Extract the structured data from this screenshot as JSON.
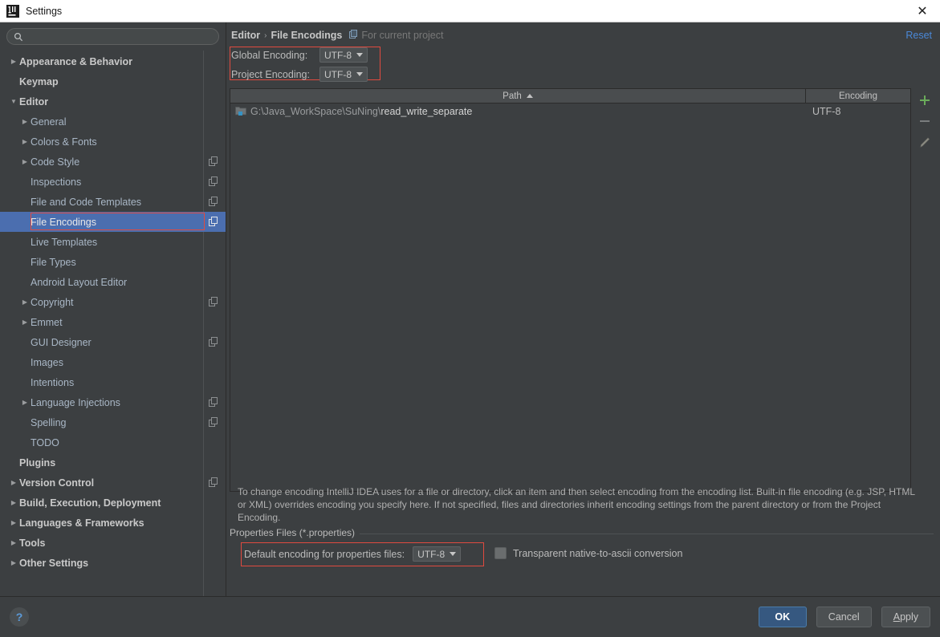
{
  "window": {
    "title": "Settings",
    "logo_text": "IJ",
    "close_icon": "✕"
  },
  "sidebar": {
    "search": {
      "placeholder": "",
      "value": "",
      "icon": "search-icon"
    },
    "items": [
      {
        "label": "Appearance & Behavior",
        "level": 0,
        "arrow": "▶",
        "bold": true,
        "selected": false,
        "mod": false
      },
      {
        "label": "Keymap",
        "level": 0,
        "arrow": "",
        "bold": true,
        "selected": false,
        "mod": false
      },
      {
        "label": "Editor",
        "level": 0,
        "arrow": "▼",
        "bold": true,
        "selected": false,
        "mod": false
      },
      {
        "label": "General",
        "level": 1,
        "arrow": "▶",
        "bold": false,
        "selected": false,
        "mod": false
      },
      {
        "label": "Colors & Fonts",
        "level": 1,
        "arrow": "▶",
        "bold": false,
        "selected": false,
        "mod": false
      },
      {
        "label": "Code Style",
        "level": 1,
        "arrow": "▶",
        "bold": false,
        "selected": false,
        "mod": true
      },
      {
        "label": "Inspections",
        "level": 1,
        "arrow": "",
        "bold": false,
        "selected": false,
        "mod": true
      },
      {
        "label": "File and Code Templates",
        "level": 1,
        "arrow": "",
        "bold": false,
        "selected": false,
        "mod": true
      },
      {
        "label": "File Encodings",
        "level": 1,
        "arrow": "",
        "bold": false,
        "selected": true,
        "mod": true
      },
      {
        "label": "Live Templates",
        "level": 1,
        "arrow": "",
        "bold": false,
        "selected": false,
        "mod": false
      },
      {
        "label": "File Types",
        "level": 1,
        "arrow": "",
        "bold": false,
        "selected": false,
        "mod": false
      },
      {
        "label": "Android Layout Editor",
        "level": 1,
        "arrow": "",
        "bold": false,
        "selected": false,
        "mod": false
      },
      {
        "label": "Copyright",
        "level": 1,
        "arrow": "▶",
        "bold": false,
        "selected": false,
        "mod": true
      },
      {
        "label": "Emmet",
        "level": 1,
        "arrow": "▶",
        "bold": false,
        "selected": false,
        "mod": false
      },
      {
        "label": "GUI Designer",
        "level": 1,
        "arrow": "",
        "bold": false,
        "selected": false,
        "mod": true
      },
      {
        "label": "Images",
        "level": 1,
        "arrow": "",
        "bold": false,
        "selected": false,
        "mod": false
      },
      {
        "label": "Intentions",
        "level": 1,
        "arrow": "",
        "bold": false,
        "selected": false,
        "mod": false
      },
      {
        "label": "Language Injections",
        "level": 1,
        "arrow": "▶",
        "bold": false,
        "selected": false,
        "mod": true
      },
      {
        "label": "Spelling",
        "level": 1,
        "arrow": "",
        "bold": false,
        "selected": false,
        "mod": true
      },
      {
        "label": "TODO",
        "level": 1,
        "arrow": "",
        "bold": false,
        "selected": false,
        "mod": false
      },
      {
        "label": "Plugins",
        "level": 0,
        "arrow": "",
        "bold": true,
        "selected": false,
        "mod": false
      },
      {
        "label": "Version Control",
        "level": 0,
        "arrow": "▶",
        "bold": true,
        "selected": false,
        "mod": true
      },
      {
        "label": "Build, Execution, Deployment",
        "level": 0,
        "arrow": "▶",
        "bold": true,
        "selected": false,
        "mod": false
      },
      {
        "label": "Languages & Frameworks",
        "level": 0,
        "arrow": "▶",
        "bold": true,
        "selected": false,
        "mod": false
      },
      {
        "label": "Tools",
        "level": 0,
        "arrow": "▶",
        "bold": true,
        "selected": false,
        "mod": false
      },
      {
        "label": "Other Settings",
        "level": 0,
        "arrow": "▶",
        "bold": true,
        "selected": false,
        "mod": false
      }
    ]
  },
  "content": {
    "breadcrumb": {
      "parent": "Editor",
      "separator": "›",
      "current": "File Encodings",
      "scope": "For current project"
    },
    "reset_label": "Reset",
    "global_encoding": {
      "label": "Global Encoding:",
      "value": "UTF-8"
    },
    "project_encoding": {
      "label": "Project Encoding:",
      "value": "UTF-8"
    },
    "table": {
      "columns": [
        "Path",
        "Encoding"
      ],
      "sort_column": "Path",
      "sort_direction": "asc",
      "rows": [
        {
          "path_prefix": "G:\\Java_WorkSpace\\SuNing\\",
          "path_name": "read_write_separate",
          "encoding": "UTF-8"
        }
      ]
    },
    "toolbar": {
      "add": "+",
      "remove": "−",
      "edit": "✎"
    },
    "description": "To change encoding IntelliJ IDEA uses for a file or directory, click an item and then select encoding from the encoding list. Built-in file encoding (e.g. JSP, HTML or XML) overrides encoding you specify here. If not specified, files and directories inherit encoding settings from the parent directory or from the Project Encoding.",
    "properties_group": {
      "title": "Properties Files (*.properties)",
      "default_encoding_label": "Default encoding for properties files:",
      "default_encoding_value": "UTF-8",
      "transparent_label": "Transparent native-to-ascii conversion",
      "transparent_checked": false
    }
  },
  "footer": {
    "help": "?",
    "ok": "OK",
    "cancel": "Cancel",
    "apply_prefix": "A",
    "apply_suffix": "pply"
  },
  "colors": {
    "accent_selection": "#4b6eaf",
    "annotation_red": "#e04a3f",
    "link_blue": "#4a88d8",
    "primary_button": "#365880",
    "add_green": "#6aab5a"
  }
}
